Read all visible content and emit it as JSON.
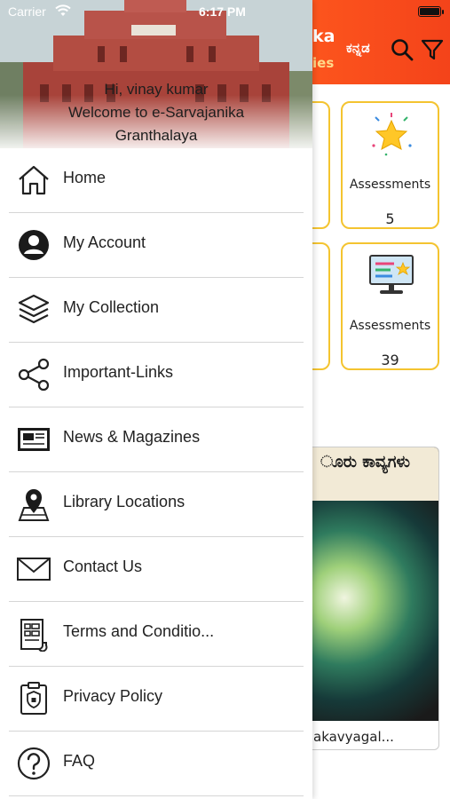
{
  "status_bar": {
    "carrier": "Carrier",
    "time": "6:17 PM"
  },
  "header": {
    "title_fragment": "ka",
    "subtitle_fragment": "ies",
    "language_toggle": "ಕನ್ನಡ",
    "accent_color": "#ff5a1e"
  },
  "cards": [
    {
      "label": "Assessments",
      "count": "5",
      "icon": "star-icon"
    },
    {
      "label": "Assessments",
      "count": "39",
      "icon": "monitor-star-icon"
    }
  ],
  "book": {
    "title": "akavyagal...",
    "cover_text": "ೂರು ಕಾವ್ಯಗಳು"
  },
  "drawer": {
    "greeting_line1": "Hi, vinay kumar",
    "greeting_line2": "Welcome to e-Sarvajanika",
    "greeting_line3": "Granthalaya",
    "menu": [
      {
        "label": "Home",
        "icon": "home-icon"
      },
      {
        "label": "My Account",
        "icon": "account-icon"
      },
      {
        "label": "My Collection",
        "icon": "layers-icon"
      },
      {
        "label": "Important-Links",
        "icon": "share-links-icon"
      },
      {
        "label": "News & Magazines",
        "icon": "newspaper-icon"
      },
      {
        "label": "Library Locations",
        "icon": "map-pin-icon"
      },
      {
        "label": "Contact Us",
        "icon": "mail-icon"
      },
      {
        "label": "Terms and Conditio...",
        "icon": "document-icon"
      },
      {
        "label": "Privacy Policy",
        "icon": "privacy-shield-icon"
      },
      {
        "label": "FAQ",
        "icon": "question-icon"
      }
    ]
  }
}
